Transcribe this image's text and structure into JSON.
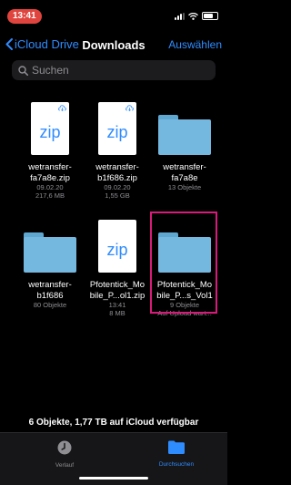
{
  "status": {
    "time": "13:41"
  },
  "nav": {
    "back_label": "iCloud Drive",
    "title": "Downloads",
    "select_label": "Auswählen"
  },
  "search": {
    "placeholder": "Suchen"
  },
  "items": [
    {
      "kind": "zip",
      "ext": "zip",
      "name1": "wetransfer-",
      "name2": "fa7a8e.zip",
      "meta1": "09.02.20",
      "meta2": "217,6 MB"
    },
    {
      "kind": "zip",
      "ext": "zip",
      "name1": "wetransfer-",
      "name2": "b1f686.zip",
      "meta1": "09.02.20",
      "meta2": "1,55 GB"
    },
    {
      "kind": "folder",
      "name1": "wetransfer-",
      "name2": "fa7a8e",
      "meta1": "13 Objekte",
      "meta2": ""
    },
    {
      "kind": "folder",
      "name1": "wetransfer-",
      "name2": "b1f686",
      "meta1": "80 Objekte",
      "meta2": ""
    },
    {
      "kind": "zip",
      "ext": "zip",
      "name1": "Pfotentick_Mo",
      "name2": "bile_P...ol1.zip",
      "meta1": "13:41",
      "meta2": "8 MB"
    },
    {
      "kind": "folder",
      "name1": "Pfotentick_Mo",
      "name2": "bile_P...s_Vol1",
      "meta1": "9 Objekte",
      "meta2": "Auf Upload wart..."
    }
  ],
  "footer": {
    "info": "6 Objekte, 1,77 TB auf iCloud verfügbar"
  },
  "tabbar": {
    "recent_label": "Verlauf",
    "browse_label": "Durchsuchen",
    "active_color": "#2f8cff",
    "inactive_color": "#8e8e93"
  },
  "colors": {
    "accent": "#2f8cff",
    "highlight": "#d81b7a",
    "time_pill": "#e0443e"
  }
}
